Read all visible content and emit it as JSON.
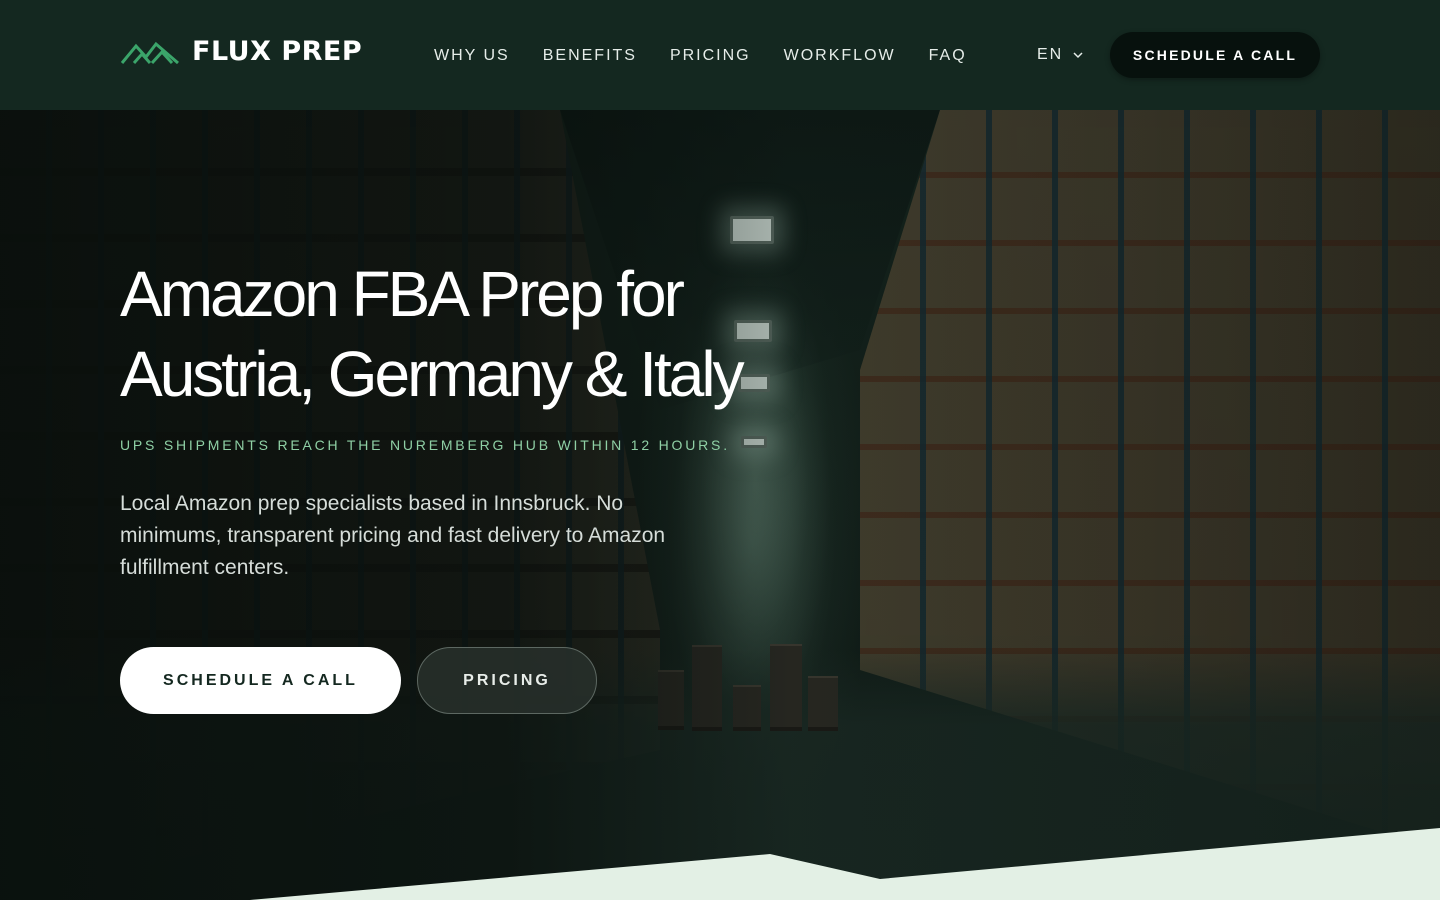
{
  "brand": {
    "name": "FLUX PREP",
    "logo_icon": "mountain-icon",
    "accent": "#3ba56a"
  },
  "nav": {
    "items": [
      {
        "label": "WHY US"
      },
      {
        "label": "BENEFITS"
      },
      {
        "label": "PRICING"
      },
      {
        "label": "WORKFLOW"
      },
      {
        "label": "FAQ"
      }
    ],
    "language": "EN",
    "language_icon": "chevron-down-icon",
    "cta": "SCHEDULE A CALL"
  },
  "hero": {
    "title_line1": "Amazon FBA Prep for",
    "title_line2": "Austria, Germany & Italy",
    "tagline": "UPS SHIPMENTS REACH THE NUREMBERG HUB WITHIN 12 HOURS.",
    "description": "Local Amazon prep specialists based in Innsbruck. No minimums, transparent pricing and fast delivery to Amazon fulfillment centers.",
    "primary_cta": "SCHEDULE A CALL",
    "secondary_cta": "PRICING",
    "background": "warehouse aisle photo",
    "colors": {
      "header_bg": "#142820",
      "tagline": "#8fd0a5",
      "wave": "#e3f0e5"
    }
  }
}
